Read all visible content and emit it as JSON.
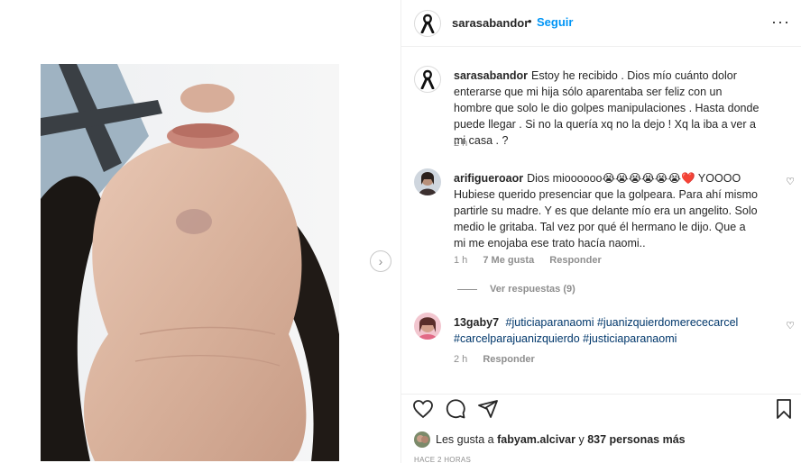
{
  "post": {
    "author": "sarasabandor",
    "dot": "•",
    "follow_label": "Seguir",
    "more_icon": "more-horizontal-icon"
  },
  "caption": {
    "username": "sarasabandor",
    "text": "Estoy he recibido . Dios mío cuánto dolor enterarse que mi hija sólo aparentaba ser feliz con un hombre que solo le dio golpes manipulaciones . Hasta donde puede llegar . Si no la quería xq no la dejo ! Xq la iba a ver a mi casa . ?",
    "time": "2 h"
  },
  "comments": [
    {
      "username": "arifigueroaor",
      "text": "Dios mioooooo😭😭😭😭😭😭❤️ YOOOO Hubiese querido presenciar que la golpeara. Para ahí mismo partirle su madre. Y es que delante mío era un angelito. Solo medio le gritaba. Tal vez por qué él hermano le dijo. Que a mi me enojaba ese trato hacía naomi..",
      "time": "1 h",
      "likes": "7 Me gusta",
      "reply": "Responder",
      "view_replies": "Ver respuestas (9)"
    },
    {
      "username": "13gaby7",
      "hashtags": [
        "#juticiaparanaomi",
        "#juanizquierdomerececarcel",
        "#carcelparajuanizquierdo",
        "#justiciaparanaomi"
      ],
      "time": "2 h",
      "reply": "Responder"
    }
  ],
  "likes": {
    "prefix": "Les gusta a",
    "user": "fabyam.alcivar",
    "middle": "y",
    "others": "837 personas más"
  },
  "timestamp": "HACE 2 HORAS",
  "colors": {
    "link_blue": "#0095f6",
    "hashtag_blue": "#00376b",
    "muted": "#8e8e8e",
    "text": "#262626"
  }
}
